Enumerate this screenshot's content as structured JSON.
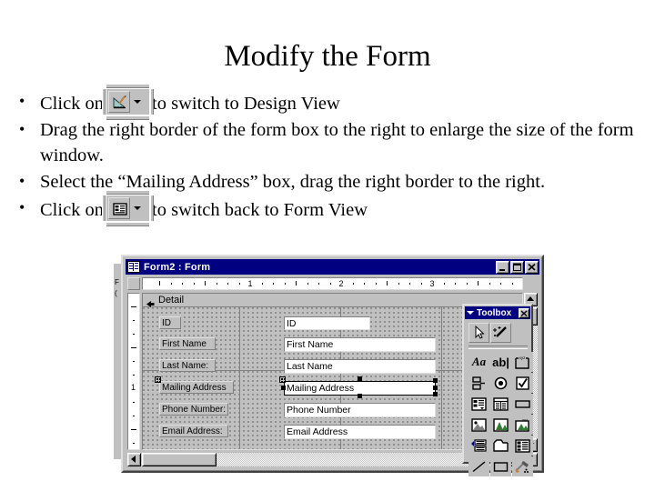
{
  "slide": {
    "title": "Modify the Form",
    "bullets": [
      {
        "id": "bullet-design-view",
        "pre": "Click on",
        "icon": "design-view-button-icon",
        "post": "to switch to Design View"
      },
      {
        "id": "bullet-drag-border",
        "pre": "Drag the right border of the form box to the right to enlarge the size of the form window.",
        "icon": null,
        "post": ""
      },
      {
        "id": "bullet-select-mailing",
        "pre": "Select the “Mailing Address” box, drag the right border to the right.",
        "icon": null,
        "post": ""
      },
      {
        "id": "bullet-form-view",
        "pre": "Click on",
        "icon": "form-view-button-icon",
        "post": "to switch back to Form View"
      }
    ]
  },
  "access_window": {
    "title": "Form2 : Form",
    "icon": "form-object-icon",
    "window_buttons": [
      {
        "name": "minimize-button",
        "glyph": "minimize-icon"
      },
      {
        "name": "maximize-button",
        "glyph": "maximize-icon"
      },
      {
        "name": "close-button",
        "glyph": "close-icon"
      }
    ],
    "horizontal_ruler": {
      "numbers": [
        "1",
        "2",
        "3"
      ],
      "unit": "inches"
    },
    "vertical_ruler": {
      "numbers": [
        "1"
      ],
      "unit": "inches"
    },
    "section": {
      "label": "Detail",
      "collapse_icon": "section-collapse-icon"
    },
    "controls": [
      {
        "label": "ID",
        "textbox": "ID",
        "selected": false
      },
      {
        "label": "First Name",
        "textbox": "First Name",
        "selected": false
      },
      {
        "label": "Last Name:",
        "textbox": "Last Name",
        "selected": false
      },
      {
        "label": "Mailing Address",
        "textbox": "Mailing Address",
        "selected": true
      },
      {
        "label": "Phone Number:",
        "textbox": "Phone Number",
        "selected": false
      },
      {
        "label": "Email Address:",
        "textbox": "Email Address",
        "selected": false
      }
    ],
    "scrollbars": {
      "horizontal_name": "horizontal-scrollbar",
      "vertical_name": "vertical-scrollbar"
    }
  },
  "toolbox": {
    "title": "Toolbox",
    "close_label": "×",
    "top_tools": [
      {
        "name": "select-objects-tool",
        "icon": "arrow-pointer-icon",
        "active": true
      },
      {
        "name": "control-wizards-tool",
        "icon": "magic-wand-icon",
        "active": false
      }
    ],
    "tools": [
      {
        "name": "label-tool",
        "icon": "label-Aa-icon",
        "text": "Aa"
      },
      {
        "name": "text-box-tool",
        "icon": "textbox-abl-icon",
        "text": "ab|"
      },
      {
        "name": "option-group-tool",
        "icon": "option-group-xyz-icon",
        "text": ""
      },
      {
        "name": "toggle-button-tool",
        "icon": "toggle-button-icon",
        "text": ""
      },
      {
        "name": "option-button-tool",
        "icon": "radio-button-icon",
        "text": ""
      },
      {
        "name": "check-box-tool",
        "icon": "check-box-icon",
        "text": ""
      },
      {
        "name": "combo-box-tool",
        "icon": "combo-box-icon",
        "text": ""
      },
      {
        "name": "list-box-tool",
        "icon": "list-box-icon",
        "text": ""
      },
      {
        "name": "command-button-tool",
        "icon": "command-button-icon",
        "text": ""
      },
      {
        "name": "image-tool",
        "icon": "image-frame-icon",
        "text": ""
      },
      {
        "name": "unbound-object-tool",
        "icon": "unbound-object-icon",
        "text": ""
      },
      {
        "name": "bound-object-tool",
        "icon": "bound-object-icon",
        "text": ""
      },
      {
        "name": "page-break-tool",
        "icon": "page-break-icon",
        "text": ""
      },
      {
        "name": "tab-control-tool",
        "icon": "tab-control-icon",
        "text": ""
      },
      {
        "name": "subform-tool",
        "icon": "subform-subreport-icon",
        "text": ""
      },
      {
        "name": "line-tool",
        "icon": "line-icon",
        "text": ""
      },
      {
        "name": "rectangle-tool",
        "icon": "rectangle-icon",
        "text": ""
      },
      {
        "name": "more-controls-tool",
        "icon": "more-controls-hammer-icon",
        "text": ""
      }
    ]
  },
  "colors": {
    "titlebar": "#000080",
    "window_face": "#c0c0c0",
    "slide_bg": "#ffffff",
    "text": "#000000",
    "field_bg": "#ffffff"
  }
}
